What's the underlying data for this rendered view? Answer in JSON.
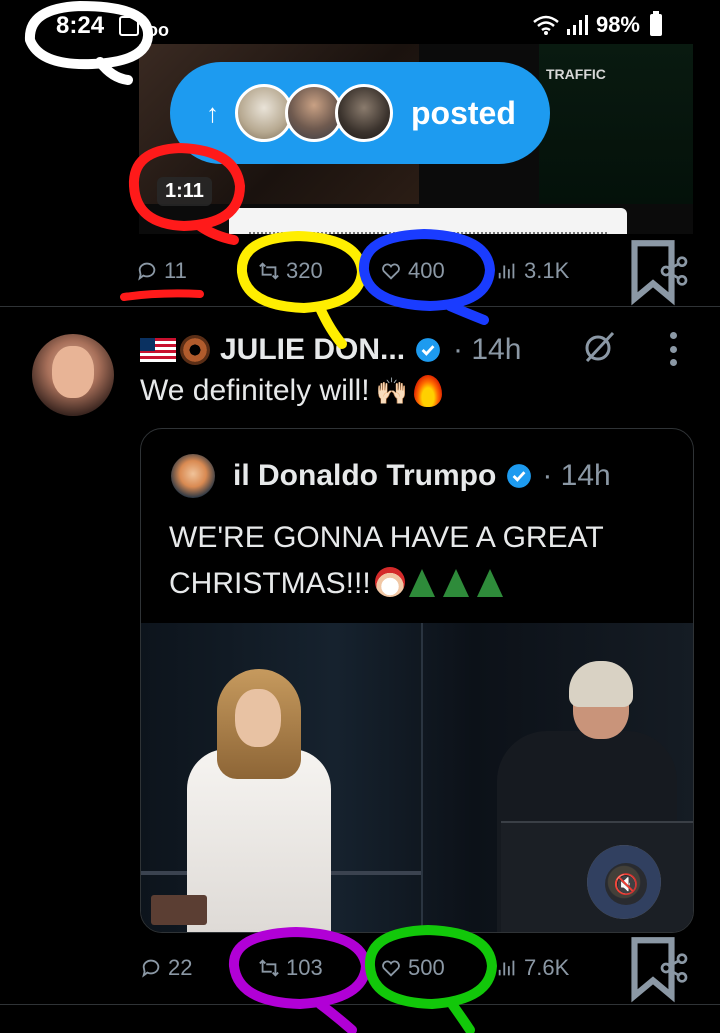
{
  "status_bar": {
    "time": "8:24",
    "voicemail_glyph": "oo",
    "battery": "98%",
    "icons": [
      "gallery-icon",
      "voicemail-icon",
      "wifi-icon",
      "signal-icon",
      "battery-icon"
    ]
  },
  "top_tweet": {
    "media_label": "TRAFFIC",
    "duration": "1:11",
    "posted_pill": {
      "arrow": "↑",
      "label": "posted"
    },
    "actions": {
      "replies": "11",
      "reposts": "320",
      "likes": "400",
      "views": "3.1K"
    }
  },
  "tweet": {
    "author_name": "JULIE DON...",
    "time": "· 14h",
    "text": "We definitely will!",
    "emoji_hands": "🙌🏻",
    "quote": {
      "author_name": "il Donaldo Trumpo",
      "time": "· 14h",
      "text": "WE'RE GONNA HAVE A GREAT CHRISTMAS!!!",
      "mute_glyph": "🔇"
    },
    "actions": {
      "replies": "22",
      "reposts": "103",
      "likes": "500",
      "views": "7.6K"
    }
  },
  "colors": {
    "background": "#000000",
    "accent_blue": "#1d9bf0",
    "muted_text": "#8b98a5",
    "divider": "#2f3336",
    "annotation_white": "#ffffff",
    "annotation_red": "#ff1a1a",
    "annotation_yellow": "#ffee00",
    "annotation_blue": "#1a3cff",
    "annotation_purple": "#b100d6",
    "annotation_green": "#12c80a"
  }
}
